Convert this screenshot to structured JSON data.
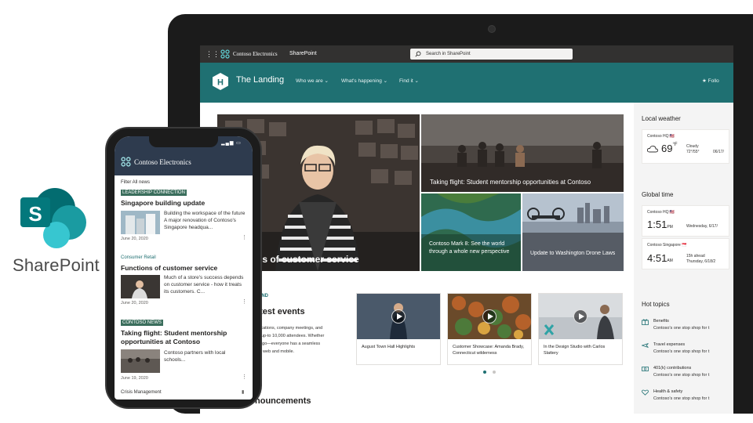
{
  "brand": {
    "product_name": "SharePoint",
    "colors": {
      "sp_dark": "#036c70",
      "sp_mid": "#1a9ba1",
      "sp_light": "#37c6d0",
      "teal_header": "#1f7072",
      "suite_bar": "#323130",
      "phone_header": "#2e3b4e"
    }
  },
  "suite_bar": {
    "waffle_icon": "waffle-icon",
    "company": "Contoso Electronics",
    "app": "SharePoint",
    "search_placeholder": "Search in SharePoint"
  },
  "site_header": {
    "logo_letter": "H",
    "title": "The Landing",
    "nav": [
      "Who we are",
      "What's happening",
      "Find it"
    ],
    "follow": "★ Follo"
  },
  "hero": {
    "main_caption": "ns of customer service",
    "top_right_caption": "Taking flight: Student mentorship opportunities at Contoso",
    "bottom_left_caption": "Contoso Mark 8: See the world through a whole new perspective",
    "bottom_right_caption": "Update to Washington Drone Laws"
  },
  "events": {
    "eyebrow": "AND",
    "title": "atest events",
    "desc_lines": [
      "unications, company meetings, and",
      "for up-to 10,000 attendees. Whether",
      "the go—everyone has a seamless",
      "oss web and mobile."
    ],
    "videos": [
      {
        "caption": "August Town Hall Highlights"
      },
      {
        "caption": "Customer Showcase: Amanda Brady, Connecticut wilderness"
      },
      {
        "caption": "In the Design Studio with Carlos Slattery"
      }
    ],
    "announcements_title": "nouncements"
  },
  "right_column": {
    "weather": {
      "title": "Local weather",
      "location": "Contoso HQ 🇺🇸",
      "temp": "69",
      "unit": "°F",
      "condition": "Cloudy",
      "range": "72°/55°",
      "date": "06/17/"
    },
    "time": {
      "title": "Global time",
      "clocks": [
        {
          "location": "Contoso HQ 🇺🇸",
          "time": "1:51",
          "ampm": "PM",
          "date": "Wednesday, 6/17/"
        },
        {
          "location": "Contoso Singapore 🇸🇬",
          "time": "4:51",
          "ampm": "AM",
          "offset": "15h ahead",
          "date": "Thursday, 6/18/2"
        }
      ]
    },
    "hot_topics": {
      "title": "Hot topics",
      "items": [
        {
          "name": "Benefits",
          "desc": "Contoso's one stop shop for t",
          "icon": "benefits-icon"
        },
        {
          "name": "Travel expenses",
          "desc": "Contoso's one stop shop for t",
          "icon": "airplane-icon"
        },
        {
          "name": "401(k) contributions",
          "desc": "Contoso's one stop shop for t",
          "icon": "money-icon"
        },
        {
          "name": "Health & safety",
          "desc": "Contoso's one stop shop for t",
          "icon": "heart-icon"
        }
      ]
    }
  },
  "phone": {
    "time": "",
    "company": "Contoso Electronics",
    "filter": "Filter All news",
    "posts": [
      {
        "tag": "LEADERSHIP CONNECTION",
        "tag_style": "badge",
        "title": "Singapore building update",
        "body": "Building the workspace of the future A major renovation of Contoso's Singapore headqua...",
        "date": "June 20, 2020"
      },
      {
        "tag": "Consumer Retail",
        "tag_style": "plain",
        "title": "Functions of customer service",
        "body": "Much of a store's success depends on customer service - how it treats its customers. C...",
        "date": "June 20, 2020"
      },
      {
        "tag": "CONTOSO NEWS",
        "tag_style": "badge",
        "title": "Taking flight: Student mentorship opportunities at Contoso",
        "body": "Contoso partners with local schools...",
        "date": "June 19, 2020"
      }
    ],
    "footer_item": "Crisis Management"
  }
}
